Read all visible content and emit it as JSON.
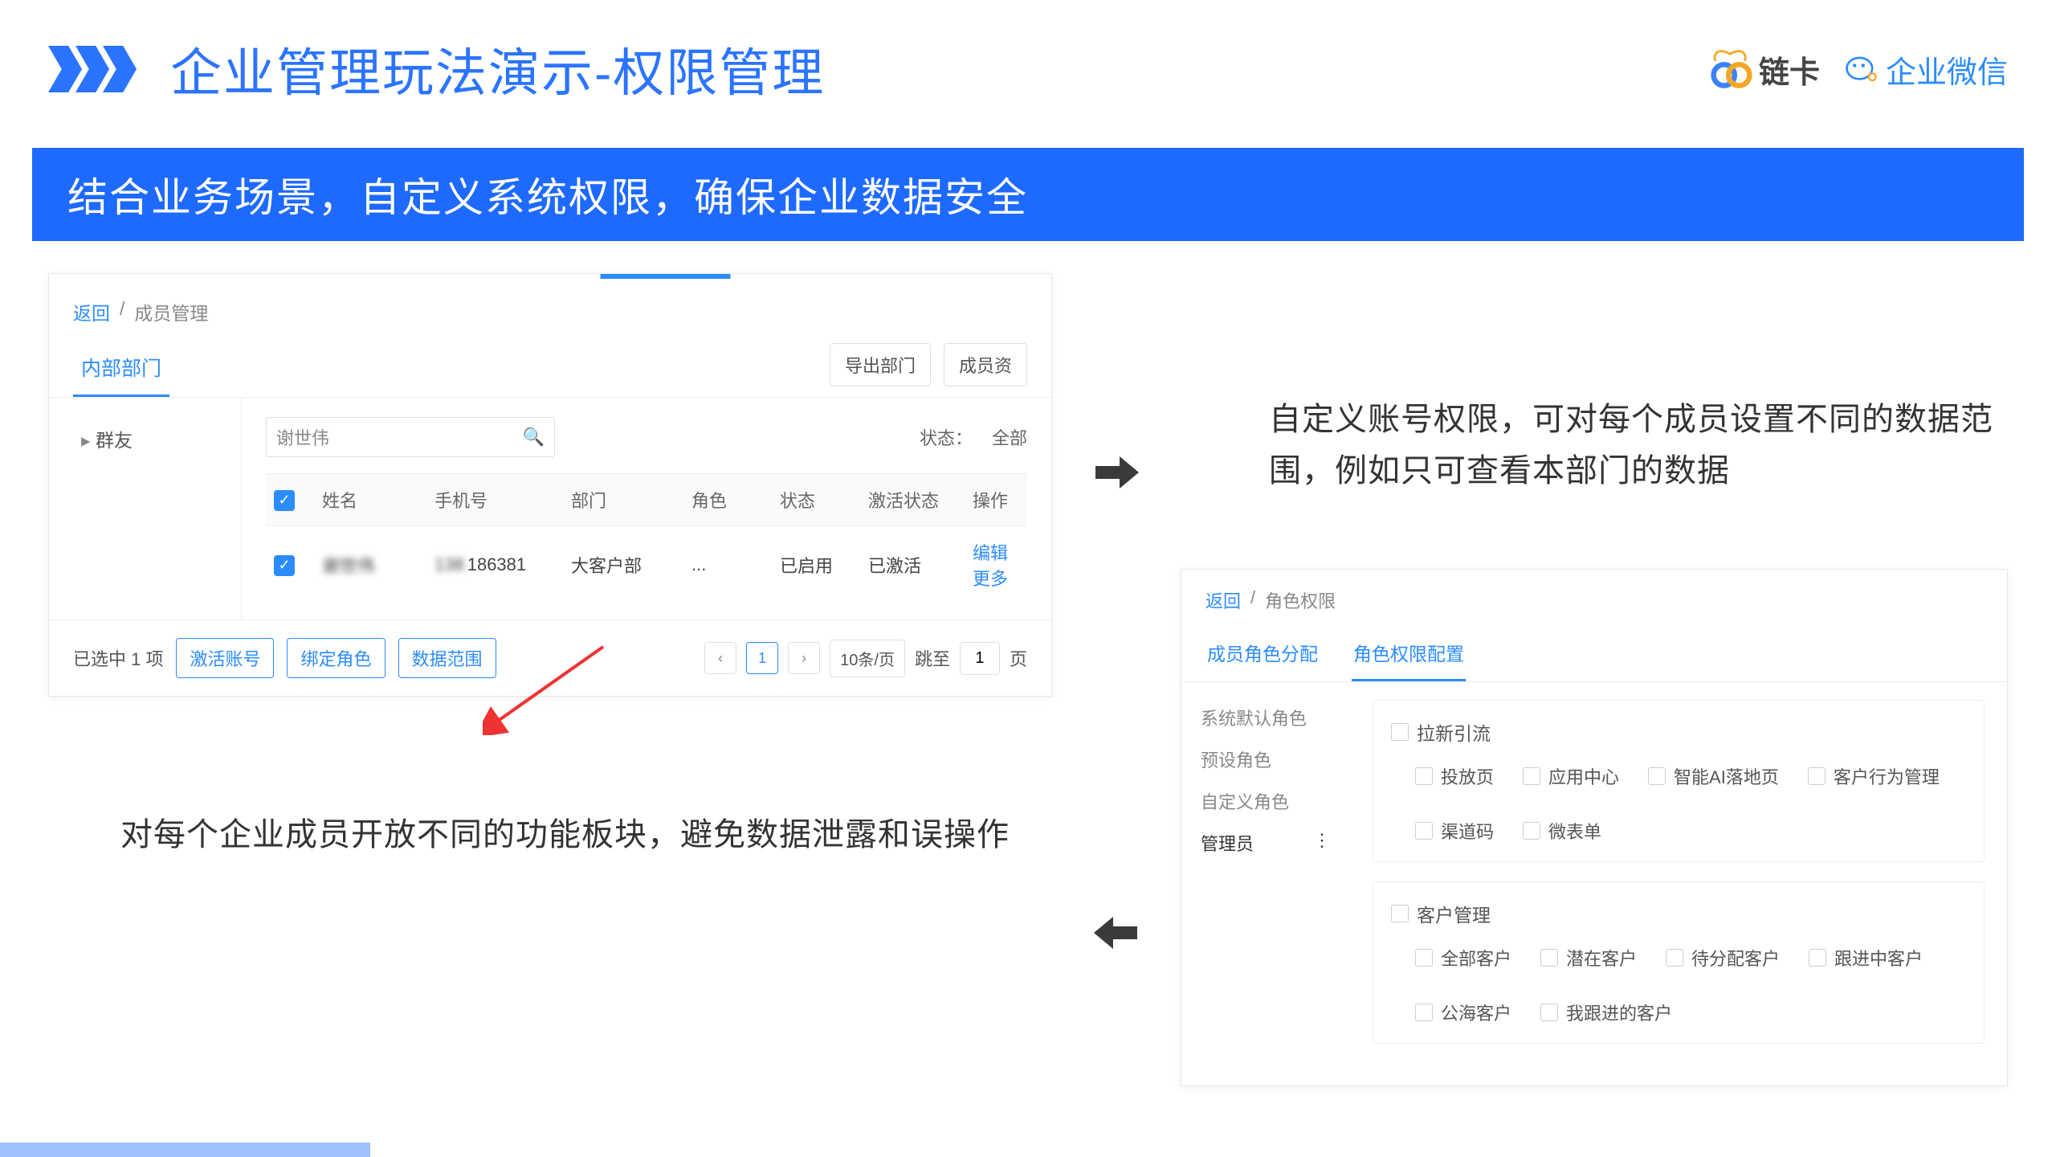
{
  "title": "企业管理玩法演示-权限管理",
  "subtitle": "结合业务场景，自定义系统权限，确保企业数据安全",
  "logo_lk": "链卡",
  "logo_wx": "企业微信",
  "panel1": {
    "bc_back": "返回",
    "bc_cur": "成员管理",
    "tab": "内部部门",
    "btn_export": "导出部门",
    "btn_member": "成员资",
    "tree_item": "群友",
    "search_value": "谢世伟",
    "status_label": "状态：",
    "status_value": "全部",
    "headers": {
      "name": "姓名",
      "phone": "手机号",
      "dept": "部门",
      "role": "角色",
      "state": "状态",
      "act": "激活状态",
      "op": "操作"
    },
    "row": {
      "name": "谢世伟",
      "phone_mask": "186381",
      "dept": "大客户部",
      "role": "...",
      "state": "已启用",
      "act": "已激活",
      "op_edit": "编辑",
      "op_more": "更多"
    },
    "footer_selected": "已选中 1 项",
    "btn_activate": "激活账号",
    "btn_bindrole": "绑定角色",
    "btn_datascope": "数据范围",
    "pager": {
      "cur": "1",
      "size": "10条/页",
      "jump": "跳至",
      "jump_val": "1",
      "jump_suffix": "页"
    }
  },
  "callout_right": "自定义账号权限，可对每个成员设置不同的数据范围，例如只可查看本部门的数据",
  "callout_left": "对每个企业成员开放不同的功能板块，避免数据泄露和误操作",
  "panel2": {
    "bc_back": "返回",
    "bc_cur": "角色权限",
    "tab1": "成员角色分配",
    "tab2": "角色权限配置",
    "side": {
      "sys": "系统默认角色",
      "preset": "预设角色",
      "custom": "自定义角色",
      "admin": "管理员"
    },
    "group1_title": "拉新引流",
    "group1_items": [
      "投放页",
      "应用中心",
      "智能AI落地页",
      "客户行为管理",
      "渠道码",
      "微表单"
    ],
    "group2_title": "客户管理",
    "group2_items": [
      "全部客户",
      "潜在客户",
      "待分配客户",
      "跟进中客户",
      "公海客户",
      "我跟进的客户"
    ]
  }
}
